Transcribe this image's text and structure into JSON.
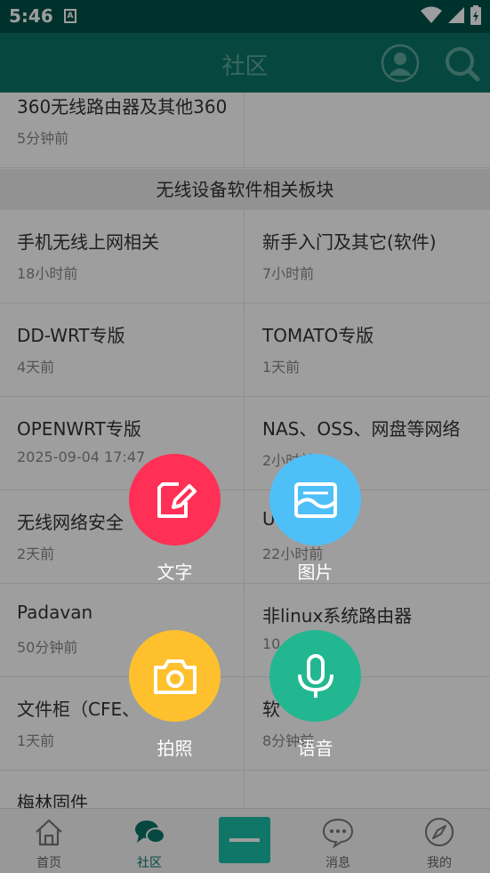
{
  "status_bar": {
    "time": "5:46",
    "sim_label": "A"
  },
  "header": {
    "title": "社区"
  },
  "sections": {
    "top_rows": [
      {
        "left": {
          "name": "360无线路由器及其他360",
          "time": "5分钟前"
        }
      }
    ],
    "wireless_software": {
      "title": "无线设备软件相关板块",
      "rows": [
        {
          "left": {
            "name": "手机无线上网相关",
            "time": "18小时前"
          },
          "right": {
            "name": "新手入门及其它(软件)",
            "time": "7小时前"
          }
        },
        {
          "left": {
            "name": "DD-WRT专版",
            "time": "4天前"
          },
          "right": {
            "name": "TOMATO专版",
            "time": "1天前"
          }
        },
        {
          "left": {
            "name": "OPENWRT专版",
            "time": "2025-09-04 17:47"
          },
          "right": {
            "name": "NAS、OSS、网盘等网络",
            "time": "2小时前"
          }
        },
        {
          "left": {
            "name": "无线网络安全",
            "time": "2天前"
          },
          "right": {
            "name": "U",
            "time": "22小时前"
          }
        },
        {
          "left": {
            "name": "Padavan",
            "time": "50分钟前"
          },
          "right": {
            "name": "非linux系统路由器",
            "time": "10"
          }
        },
        {
          "left": {
            "name": "文件柜（CFE、",
            "time": "1天前"
          },
          "right": {
            "name": "软",
            "time": "8分钟前"
          }
        },
        {
          "left": {
            "name": "梅林固件",
            "time": ""
          }
        }
      ]
    }
  },
  "overlay": {
    "actions": [
      {
        "label": "文字",
        "icon": "edit-icon",
        "color": "#ff2f55"
      },
      {
        "label": "图片",
        "icon": "image-icon",
        "color": "#4fbff8"
      },
      {
        "label": "拍照",
        "icon": "camera-icon",
        "color": "#ffc02e"
      },
      {
        "label": "语音",
        "icon": "mic-icon",
        "color": "#22b791"
      }
    ]
  },
  "bottom_nav": {
    "items": [
      {
        "label": "首页",
        "icon": "home-icon"
      },
      {
        "label": "社区",
        "icon": "chat-icon",
        "active": true
      },
      {
        "label": "消息",
        "icon": "message-icon"
      },
      {
        "label": "我的",
        "icon": "compass-icon"
      }
    ]
  },
  "colors": {
    "primary": "#0a7566",
    "accent": "#1bc0a8"
  }
}
